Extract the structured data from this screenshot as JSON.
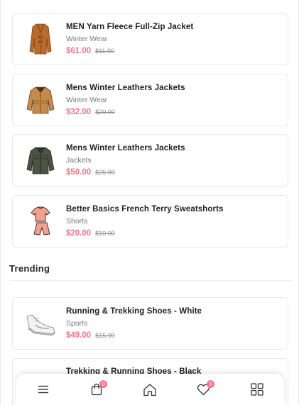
{
  "products": [
    {
      "title": "MEN Yarn Fleece Full-Zip Jacket",
      "category": "Winter Wear",
      "price": "$61.00",
      "old_price": "$11.00",
      "image": "brown-coat-image"
    },
    {
      "title": "Mens Winter Leathers Jackets",
      "category": "Winter Wear",
      "price": "$32.00",
      "old_price": "$20.00",
      "image": "tan-leather-jacket-image"
    },
    {
      "title": "Mens Winter Leathers Jackets",
      "category": "Jackets",
      "price": "$50.00",
      "old_price": "$25.00",
      "image": "green-jacket-image"
    },
    {
      "title": "Better Basics French Terry Sweatshorts",
      "category": "Shorts",
      "price": "$20.00",
      "old_price": "$10.00",
      "image": "pink-shorts-set-image"
    }
  ],
  "trending": {
    "title": "Trending",
    "items": [
      {
        "title": "Running & Trekking Shoes - White",
        "category": "Sports",
        "price": "$49.00",
        "old_price": "$15.00",
        "image": "white-shoe-image"
      },
      {
        "title": "Trekking & Running Shoes - Black",
        "category": "",
        "price": "",
        "old_price": "",
        "image": ""
      }
    ]
  },
  "bottom_nav": {
    "items": [
      {
        "icon": "menu-icon"
      },
      {
        "icon": "shopping-bag-icon",
        "badge": "0"
      },
      {
        "icon": "home-icon"
      },
      {
        "icon": "heart-icon",
        "badge": "0"
      },
      {
        "icon": "grid-icon"
      }
    ]
  },
  "colors": {
    "price": "#f3758a",
    "badge": "#f3758a",
    "text": "#222222",
    "muted": "#787878"
  }
}
